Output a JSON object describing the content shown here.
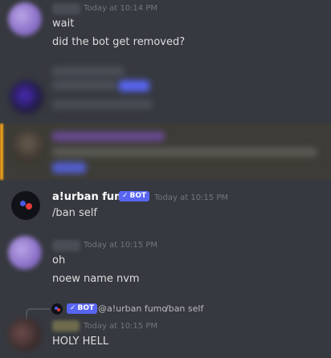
{
  "messages": [
    {
      "id": "m1",
      "timestamp": "Today at 10:14 PM",
      "lines": [
        "wait",
        "did the bot get removed?"
      ]
    },
    {
      "id": "m4",
      "username": "a!urban fumo",
      "bot_badge": "BOT",
      "timestamp": "Today at 10:15 PM",
      "lines": [
        "/ban self"
      ]
    },
    {
      "id": "m5",
      "timestamp": "Today at 10:15 PM",
      "lines": [
        "oh",
        "noew name nvm"
      ]
    },
    {
      "id": "m6",
      "reply": {
        "bot_badge": "BOT",
        "username": "@a!urban fumo",
        "text": "/ban self"
      },
      "timestamp": "Today at 10:15 PM",
      "lines": [
        "HOLY HELL"
      ]
    }
  ],
  "colors": {
    "background": "#36393f",
    "highlight_background": "#3d3c36",
    "highlight_bar": "#faa61a",
    "bot_badge": "#5865f2",
    "timestamp": "#72767d",
    "text": "#dcddde"
  },
  "icons": [
    "check-icon",
    "bot-avatar",
    "reply-spine"
  ]
}
